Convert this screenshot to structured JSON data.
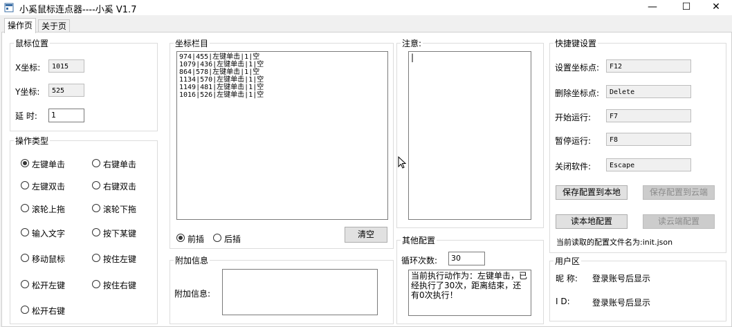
{
  "window": {
    "title": "小奚鼠标连点器----小奚 V1.7",
    "min": "—",
    "max": "☐",
    "close": "✕"
  },
  "tabs": [
    {
      "label": "操作页"
    },
    {
      "label": "关于页"
    }
  ],
  "mouse_position": {
    "title": "鼠标位置",
    "x_label": "X坐标:",
    "x_value": "1015",
    "y_label": "Y坐标:",
    "y_value": "525",
    "delay_label": "延 时:",
    "delay_value": "1"
  },
  "op_type": {
    "title": "操作类型",
    "options": [
      {
        "label": "左键单击",
        "checked": true
      },
      {
        "label": "右键单击",
        "checked": false
      },
      {
        "label": "左键双击",
        "checked": false
      },
      {
        "label": "右键双击",
        "checked": false
      },
      {
        "label": "滚轮上拖",
        "checked": false
      },
      {
        "label": "滚轮下拖",
        "checked": false
      },
      {
        "label": "输入文字",
        "checked": false
      },
      {
        "label": "按下某键",
        "checked": false
      },
      {
        "label": "移动鼠标",
        "checked": false
      },
      {
        "label": "按住左键",
        "checked": false
      },
      {
        "label": "松开左键",
        "checked": false
      },
      {
        "label": "按住右键",
        "checked": false
      },
      {
        "label": "松开右键",
        "checked": false
      }
    ]
  },
  "coords": {
    "title": "坐标栏目",
    "rows": [
      "974|455|左键单击|1|空",
      "1079|436|左键单击|1|空",
      "864|578|左键单击|1|空",
      "1134|570|左键单击|1|空",
      "1149|481|左键单击|1|空",
      "1016|526|左键单击|1|空"
    ],
    "insert_before": "前插",
    "insert_after": "后插",
    "clear": "清空"
  },
  "extra": {
    "title": "附加信息",
    "label": "附加信息:",
    "value": ""
  },
  "notice": {
    "title": "注意:",
    "text": "|"
  },
  "other": {
    "title": "其他配置",
    "loop_label": "循环次数:",
    "loop_value": "30",
    "status": "当前执行动作为：左键单击，已经执行了30次，距离结束，还有0次执行！"
  },
  "hotkeys": {
    "title": "快捷键设置",
    "items": [
      {
        "label": "设置坐标点:",
        "value": "F12"
      },
      {
        "label": "删除坐标点:",
        "value": "Delete"
      },
      {
        "label": "开始运行:",
        "value": "F7"
      },
      {
        "label": "暂停运行:",
        "value": "F8"
      },
      {
        "label": "关闭软件:",
        "value": "Escape"
      }
    ],
    "save_local": "保存配置到本地",
    "save_cloud": "保存配置到云端",
    "read_local": "读本地配置",
    "read_cloud": "读云端配置",
    "current_config": "当前读取的配置文件名为:init.json"
  },
  "user": {
    "title": "用户区",
    "nick_label": "昵 称:",
    "nick_value": "登录账号后显示",
    "id_label": "I D:",
    "id_value": "登录账号后显示"
  }
}
